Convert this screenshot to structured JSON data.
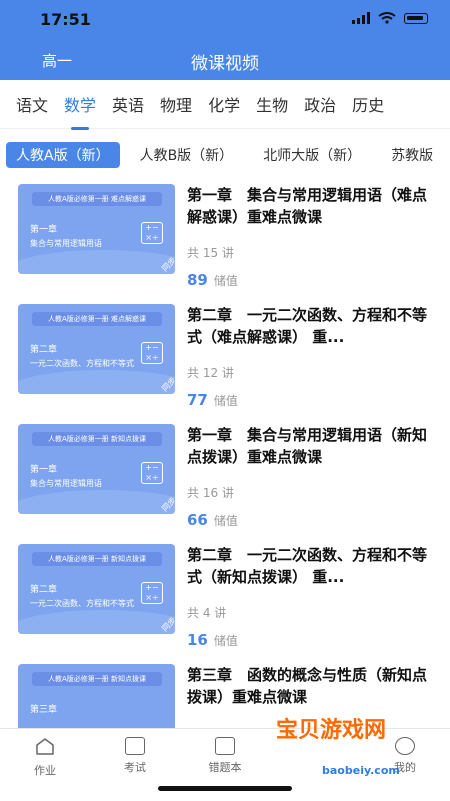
{
  "status": {
    "time": "17:51"
  },
  "header": {
    "grade": "高一",
    "title": "微课视频"
  },
  "subjects": [
    "语文",
    "数学",
    "英语",
    "物理",
    "化学",
    "生物",
    "政治",
    "历史"
  ],
  "subjects_active": 1,
  "editions": [
    "人教A版（新）",
    "人教B版（新）",
    "北师大版（新）",
    "苏教版"
  ],
  "editions_active": 0,
  "items": [
    {
      "tag": "人教A版必修第一册  难点解惑课",
      "chapter": "第一章",
      "sub": "集合与常用逻辑用语",
      "title": "第一章　集合与常用逻辑用语（难点解惑课）重难点微课",
      "count": "共 15 讲",
      "price": "89",
      "unit": "储值",
      "badge": "同步"
    },
    {
      "tag": "人教A版必修第一册  难点解惑课",
      "chapter": "第二章",
      "sub": "一元二次函数、方程和不等式",
      "title": "第二章　一元二次函数、方程和不等式（难点解惑课） 重...",
      "count": "共 12 讲",
      "price": "77",
      "unit": "储值",
      "badge": "同步"
    },
    {
      "tag": "人教A版必修第一册  新知点拨课",
      "chapter": "第一章",
      "sub": "集合与常用逻辑用语",
      "title": "第一章　集合与常用逻辑用语（新知点拨课）重难点微课",
      "count": "共 16 讲",
      "price": "66",
      "unit": "储值",
      "badge": "同步"
    },
    {
      "tag": "人教A版必修第一册  新知点拨课",
      "chapter": "第二章",
      "sub": "一元二次函数、方程和不等式",
      "title": "第二章　一元二次函数、方程和不等式（新知点拨课） 重...",
      "count": "共 4 讲",
      "price": "16",
      "unit": "储值",
      "badge": "同步"
    },
    {
      "tag": "人教A版必修第一册  新知点拨课",
      "chapter": "第三章",
      "sub": "",
      "title": "第三章　函数的概念与性质（新知点拨课）重难点微课",
      "count": "",
      "price": "",
      "unit": "",
      "badge": ""
    }
  ],
  "tabbar": [
    "作业",
    "考试",
    "错题本",
    "",
    "我的"
  ],
  "watermark": {
    "main": "宝贝游戏网",
    "url": "baobeiy.com"
  }
}
